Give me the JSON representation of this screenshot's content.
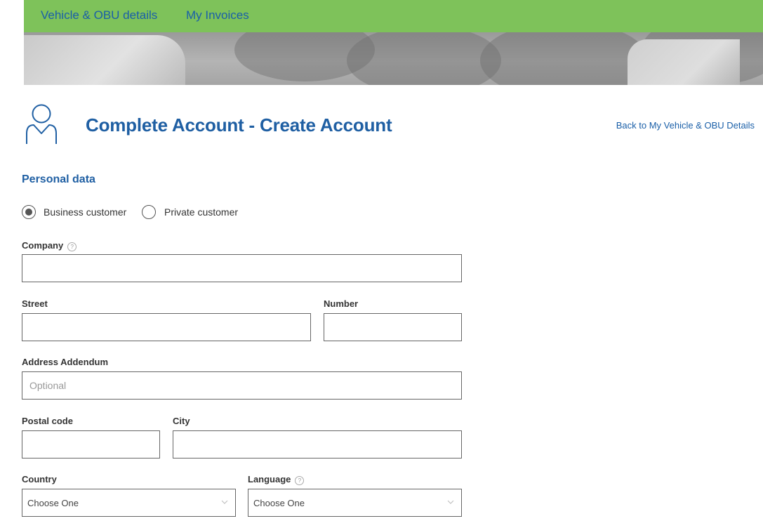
{
  "nav": {
    "items": [
      {
        "label": "Vehicle & OBU details"
      },
      {
        "label": "My Invoices"
      }
    ]
  },
  "header": {
    "title": "Complete Account - Create Account",
    "back_link": "Back to My Vehicle & OBU Details"
  },
  "form": {
    "section_title": "Personal data",
    "customer_type": {
      "options": [
        {
          "label": "Business customer",
          "checked": true
        },
        {
          "label": "Private customer",
          "checked": false
        }
      ]
    },
    "company": {
      "label": "Company",
      "value": "",
      "placeholder": ""
    },
    "street": {
      "label": "Street",
      "value": "",
      "placeholder": ""
    },
    "number": {
      "label": "Number",
      "value": "",
      "placeholder": ""
    },
    "address_addendum": {
      "label": "Address Addendum",
      "value": "",
      "placeholder": "Optional"
    },
    "postal_code": {
      "label": "Postal code",
      "value": "",
      "placeholder": ""
    },
    "city": {
      "label": "City",
      "value": "",
      "placeholder": ""
    },
    "country": {
      "label": "Country",
      "selected": "Choose One"
    },
    "language": {
      "label": "Language",
      "selected": "Choose One"
    }
  },
  "icons": {
    "user": "user-icon",
    "help": "help-circle-icon",
    "dropdown": "chevron-down-icon"
  },
  "colors": {
    "nav_background": "#7ec25a",
    "link": "#1a5fa8",
    "title": "#1f5fa3"
  }
}
